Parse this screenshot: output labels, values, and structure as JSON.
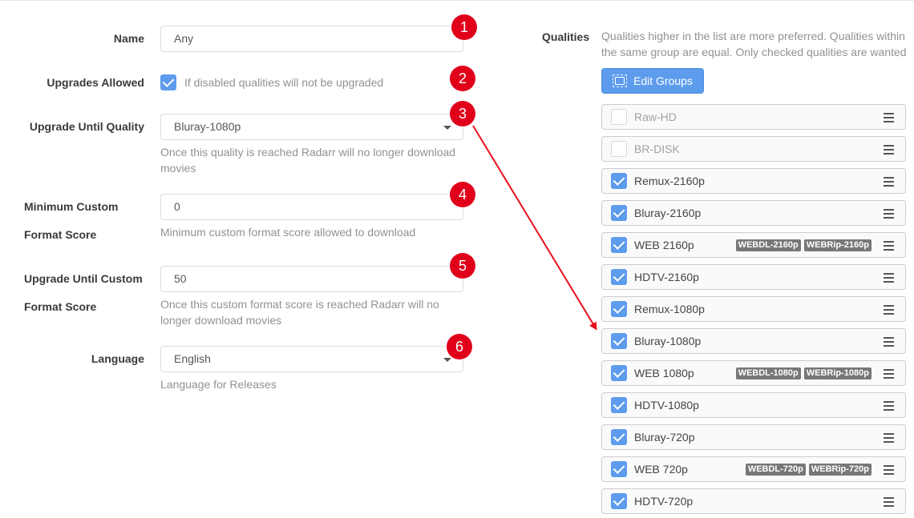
{
  "form": {
    "name": {
      "label": "Name",
      "value": "Any"
    },
    "upgrades": {
      "label": "Upgrades Allowed",
      "help": "If disabled qualities will not be upgraded",
      "checked": true
    },
    "upgrade_until_quality": {
      "label": "Upgrade Until Quality",
      "value": "Bluray-1080p",
      "help": "Once this quality is reached Radarr will no longer download movies"
    },
    "min_custom": {
      "label_line1": "Minimum Custom",
      "label_line2": "Format Score",
      "value": "0",
      "help": "Minimum custom format score allowed to download"
    },
    "until_custom": {
      "label_line1": "Upgrade Until Custom",
      "label_line2": "Format Score",
      "value": "50",
      "help": "Once this custom format score is reached Radarr will no longer download movies"
    },
    "language": {
      "label": "Language",
      "value": "English",
      "help": "Language for Releases"
    }
  },
  "markers": [
    "1",
    "2",
    "3",
    "4",
    "5",
    "6"
  ],
  "qualities": {
    "label": "Qualities",
    "help": "Qualities higher in the list are more preferred. Qualities within the same group are equal. Only checked qualities are wanted",
    "edit_groups_label": "Edit Groups",
    "items": [
      {
        "name": "Raw-HD",
        "checked": false,
        "tags": []
      },
      {
        "name": "BR-DISK",
        "checked": false,
        "tags": []
      },
      {
        "name": "Remux-2160p",
        "checked": true,
        "tags": []
      },
      {
        "name": "Bluray-2160p",
        "checked": true,
        "tags": []
      },
      {
        "name": "WEB 2160p",
        "checked": true,
        "tags": [
          "WEBDL-2160p",
          "WEBRip-2160p"
        ]
      },
      {
        "name": "HDTV-2160p",
        "checked": true,
        "tags": []
      },
      {
        "name": "Remux-1080p",
        "checked": true,
        "tags": []
      },
      {
        "name": "Bluray-1080p",
        "checked": true,
        "tags": []
      },
      {
        "name": "WEB 1080p",
        "checked": true,
        "tags": [
          "WEBDL-1080p",
          "WEBRip-1080p"
        ]
      },
      {
        "name": "HDTV-1080p",
        "checked": true,
        "tags": []
      },
      {
        "name": "Bluray-720p",
        "checked": true,
        "tags": []
      },
      {
        "name": "WEB 720p",
        "checked": true,
        "tags": [
          "WEBDL-720p",
          "WEBRip-720p"
        ]
      },
      {
        "name": "HDTV-720p",
        "checked": true,
        "tags": []
      }
    ]
  },
  "colors": {
    "accent": "#5d9cec",
    "marker": "#e0001a",
    "tag": "#777777"
  }
}
